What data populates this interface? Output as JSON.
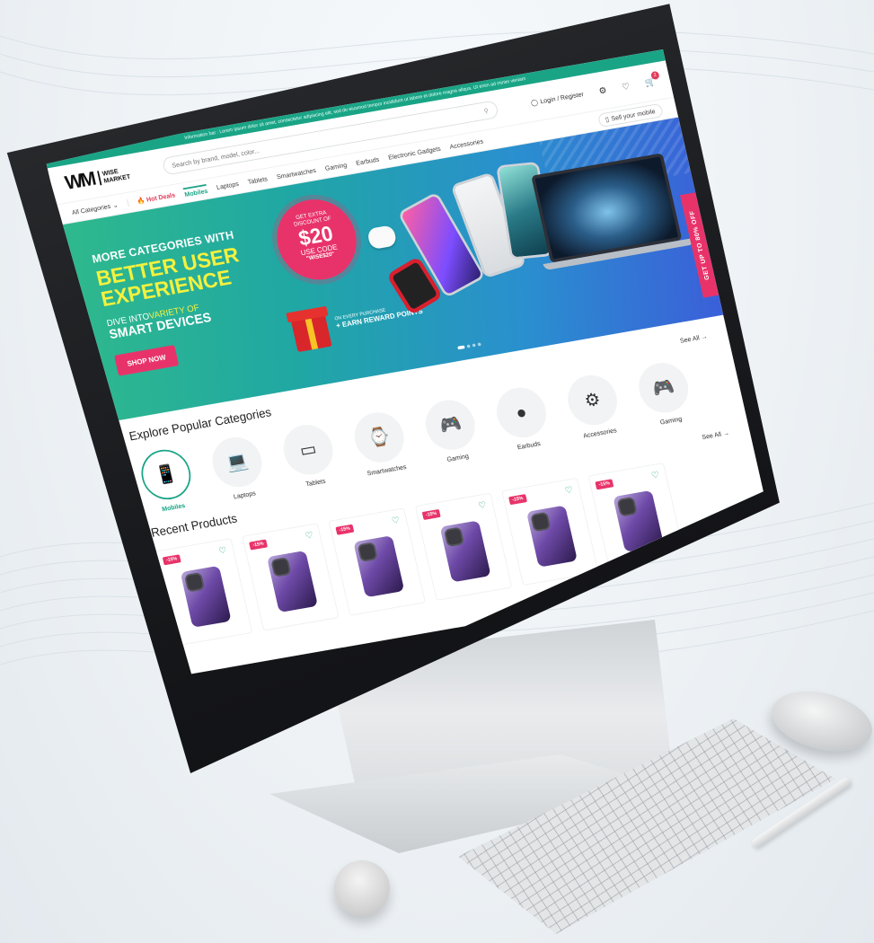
{
  "site": {
    "topbar_text": "Information bar : Lorem ipsum dolor sit amet, consectetur adipiscing elit, sed do eiusmod tempor incididunt ut labore et dolore magna aliqua. Ut enim ad minim veniam",
    "logo_mark": "WM",
    "logo_line1": "WISE",
    "logo_line2": "MARKET",
    "search_placeholder": "Search by brand, model, color...",
    "login_label": "Login / Register",
    "cart_count": "2",
    "sell_label": "Sell your mobile"
  },
  "nav": {
    "all_categories": "All Categories",
    "hot_deals": "Hot Deals",
    "items": [
      "Mobiles",
      "Laptops",
      "Tablets",
      "Smartwatches",
      "Gaming",
      "Earbuds",
      "Electronic Gadgets",
      "Accessories"
    ]
  },
  "banner": {
    "line1": "MORE CATEGORIES WITH",
    "line2": "BETTER USER",
    "line3": "EXPERIENCE",
    "line4_pre": "DIVE INTO",
    "line4_hl": "VARIETY OF",
    "line5": "SMART DEVICES",
    "cta": "SHOP NOW",
    "offer_1": "GET EXTRA",
    "offer_2": "DISCOUNT OF",
    "offer_amount": "$20",
    "offer_code_label": "USE CODE",
    "offer_code": "\"WISE$20\"",
    "reward_1": "ON EVERY PURCHASE",
    "reward_2": "+ EARN REWARD POINTS",
    "side_tab": "GET UP TO 80% OFF"
  },
  "categories": {
    "title": "Explore Popular Categories",
    "see_all": "See All →",
    "items": [
      {
        "label": "Mobiles",
        "icon": "phone-icon",
        "glyph": "📱"
      },
      {
        "label": "Laptops",
        "icon": "laptop-icon",
        "glyph": "💻"
      },
      {
        "label": "Tablets",
        "icon": "tablet-icon",
        "glyph": "▭"
      },
      {
        "label": "Smartwatches",
        "icon": "watch-icon",
        "glyph": "⌚"
      },
      {
        "label": "Gaming",
        "icon": "gamepad-icon",
        "glyph": "🎮"
      },
      {
        "label": "Earbuds",
        "icon": "earbuds-icon",
        "glyph": "●"
      },
      {
        "label": "Accessories",
        "icon": "accessories-icon",
        "glyph": "⚙"
      },
      {
        "label": "Gaming",
        "icon": "gamepad-icon",
        "glyph": "🎮"
      }
    ]
  },
  "products": {
    "title": "Recent Products",
    "see_all": "See All →",
    "items": [
      {
        "discount": "-15%"
      },
      {
        "discount": "-15%"
      },
      {
        "discount": "-15%"
      },
      {
        "discount": "-15%"
      },
      {
        "discount": "-15%"
      },
      {
        "discount": "-15%"
      }
    ]
  },
  "colors": {
    "brand_green": "#1aa486",
    "accent_pink": "#e8336a",
    "highlight_yellow": "#f3f13f"
  }
}
